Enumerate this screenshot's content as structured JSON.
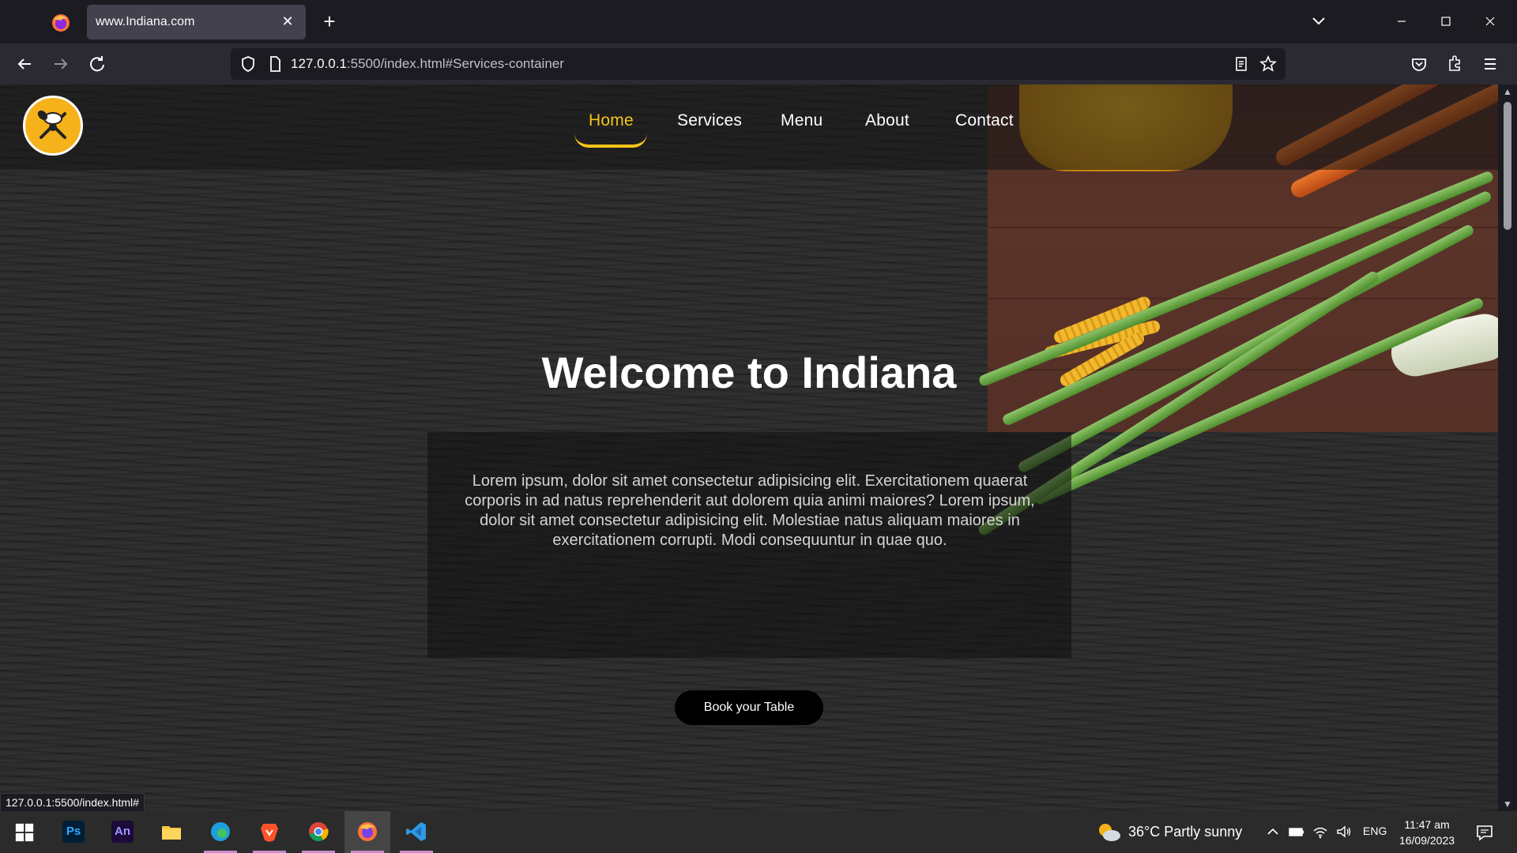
{
  "browser": {
    "tab_title": "www.Indiana.com",
    "url_host": "127.0.0.1",
    "url_rest": ":5500/index.html#Services-container",
    "status_link": "127.0.0.1:5500/index.html#"
  },
  "page": {
    "nav": [
      {
        "label": "Home",
        "active": true
      },
      {
        "label": "Services"
      },
      {
        "label": "Menu"
      },
      {
        "label": "About"
      },
      {
        "label": "Contact"
      }
    ],
    "hero_title": "Welcome to Indiana",
    "hero_text": "Lorem ipsum, dolor sit amet consectetur adipisicing elit. Exercitationem quaerat corporis in ad natus reprehenderit aut dolorem quia animi maiores? Lorem ipsum, dolor sit amet consectetur adipisicing elit. Molestiae natus aliquam maiores in exercitationem corrupti. Modi consequuntur in quae quo.",
    "cta": "Book your Table",
    "accent_color": "#f5c518"
  },
  "taskbar": {
    "apps": [
      {
        "name": "start-icon"
      },
      {
        "name": "photoshop-icon",
        "label": "Ps"
      },
      {
        "name": "animate-icon",
        "label": "An"
      },
      {
        "name": "file-explorer-icon"
      },
      {
        "name": "edge-icon"
      },
      {
        "name": "brave-icon"
      },
      {
        "name": "chrome-icon"
      },
      {
        "name": "firefox-icon"
      },
      {
        "name": "vscode-icon"
      }
    ],
    "weather": "36°C  Partly sunny",
    "language": "ENG",
    "time": "11:47 am",
    "date": "16/09/2023"
  }
}
